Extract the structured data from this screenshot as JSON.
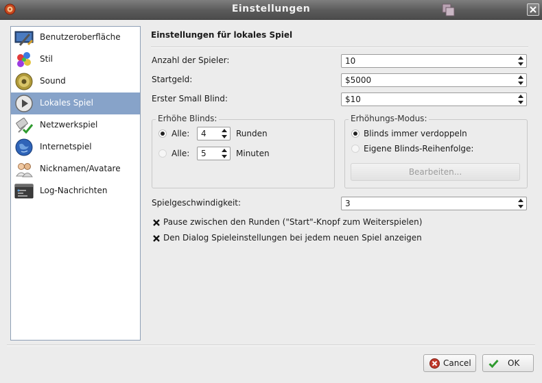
{
  "window": {
    "title": "Einstellungen"
  },
  "sidebar": {
    "items": [
      {
        "label": "Benutzeroberfläche",
        "icon": "display-settings-icon",
        "active": false
      },
      {
        "label": "Stil",
        "icon": "paint-palette-icon",
        "active": false
      },
      {
        "label": "Sound",
        "icon": "speaker-icon",
        "active": false
      },
      {
        "label": "Lokales Spiel",
        "icon": "play-icon",
        "active": true
      },
      {
        "label": "Netzwerkspiel",
        "icon": "network-icon",
        "active": false
      },
      {
        "label": "Internetspiel",
        "icon": "globe-icon",
        "active": false
      },
      {
        "label": "Nicknamen/Avatare",
        "icon": "users-icon",
        "active": false
      },
      {
        "label": "Log-Nachrichten",
        "icon": "log-console-icon",
        "active": false
      }
    ]
  },
  "main": {
    "title": "Einstellungen für lokales Spiel",
    "players": {
      "label": "Anzahl der Spieler:",
      "value": "10"
    },
    "startmoney": {
      "label": "Startgeld:",
      "value": "$5000"
    },
    "small_blind": {
      "label": "Erster Small Blind:",
      "value": "$10"
    },
    "raise_blinds": {
      "title": "Erhöhe Blinds:",
      "rounds": {
        "label": "Alle:",
        "value": "4",
        "unit": "Runden",
        "selected": true
      },
      "minutes": {
        "label": "Alle:",
        "value": "5",
        "unit": "Minuten",
        "selected": false
      }
    },
    "raise_mode": {
      "title": "Erhöhungs-Modus:",
      "double": {
        "label": "Blinds immer verdoppeln",
        "selected": true
      },
      "custom": {
        "label": "Eigene Blinds-Reihenfolge:",
        "selected": false
      },
      "edit_button": "Bearbeiten..."
    },
    "speed": {
      "label": "Spielgeschwindigkeit:",
      "value": "3"
    },
    "pause_check": {
      "label": "Pause zwischen den Runden (\"Start\"-Knopf zum Weiterspielen)",
      "checked": true
    },
    "dialog_check": {
      "label": "Den Dialog Spieleinstellungen bei jedem neuen Spiel anzeigen",
      "checked": true
    }
  },
  "footer": {
    "cancel": "Cancel",
    "ok": "OK"
  },
  "colors": {
    "selection": "#87a3c9",
    "titlebar": "#5a5a5a",
    "ok_check": "#2e9a2e",
    "cancel_icon": "#c0392b"
  }
}
